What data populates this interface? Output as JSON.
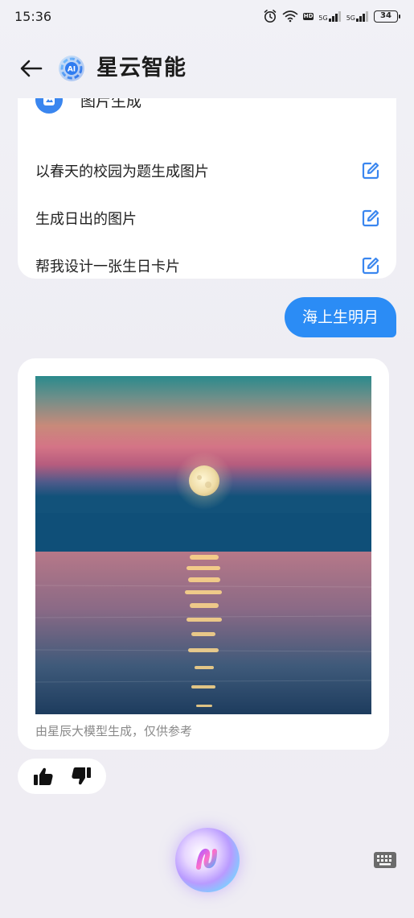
{
  "status_bar": {
    "time": "15:36",
    "battery": "34",
    "hd_label": "HD",
    "network_1": "5G",
    "network_2": "5G",
    "icons": [
      "alarm-icon",
      "wifi-icon",
      "hd-icon",
      "signal-icon",
      "signal-icon",
      "battery-icon"
    ]
  },
  "header": {
    "title": "星云智能",
    "logo_text": "AI",
    "back_icon": "arrow-left-icon"
  },
  "suggestion_card": {
    "title": "图片生成",
    "items": [
      {
        "label": "以春天的校园为题生成图片",
        "icon": "edit-icon"
      },
      {
        "label": "生成日出的图片",
        "icon": "edit-icon"
      },
      {
        "label": "帮我设计一张生日卡片",
        "icon": "edit-icon"
      }
    ]
  },
  "user_message": "海上生明月",
  "image_card": {
    "caption": "由星辰大模型生成，仅供参考"
  },
  "feedback": {
    "like_icon": "thumbs-up-icon",
    "dislike_icon": "thumbs-down-icon"
  },
  "bottom": {
    "voice_icon": "voice-orb-icon",
    "keyboard_icon": "keyboard-icon"
  },
  "colors": {
    "accent": "#2b8cf5",
    "edit_icon": "#3a86ef",
    "background": "#f0eff5"
  }
}
